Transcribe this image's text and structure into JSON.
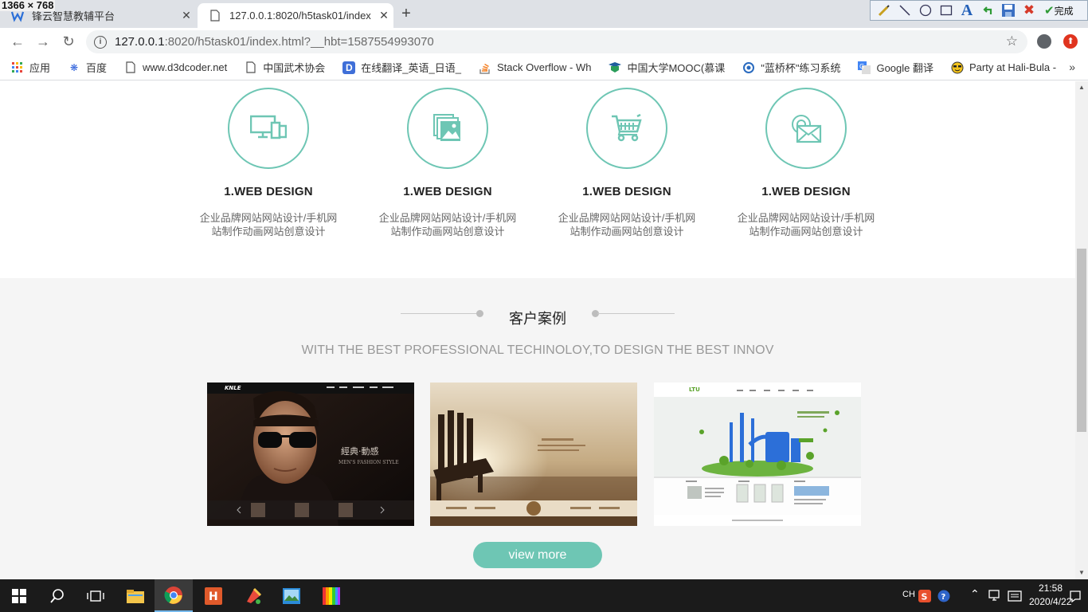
{
  "screenshot_dims": "1366 × 768",
  "browser": {
    "tabs": [
      {
        "title": "锋云智慧教辅平台",
        "active": false
      },
      {
        "title": "127.0.0.1:8020/h5task01/index",
        "active": true
      }
    ],
    "url_host": "127.0.0.1",
    "url_rest": ":8020/h5task01/index.html?__hbt=1587554993070",
    "bookmarks": [
      {
        "label": "应用",
        "icon": "apps-grid-icon"
      },
      {
        "label": "百度",
        "icon": "baidu-paw-icon"
      },
      {
        "label": "www.d3dcoder.net",
        "icon": "page-icon"
      },
      {
        "label": "中国武术协会",
        "icon": "page-icon"
      },
      {
        "label": "在线翻译_英语_日语_",
        "icon": "d-icon"
      },
      {
        "label": "Stack Overflow - Wh",
        "icon": "stackoverflow-icon"
      },
      {
        "label": "中国大学MOOC(慕课",
        "icon": "mooc-icon"
      },
      {
        "label": "\"蓝桥杯\"练习系统",
        "icon": "lanqiao-icon"
      },
      {
        "label": "Google 翻译",
        "icon": "google-translate-icon"
      },
      {
        "label": "Party at Hali-Bula -",
        "icon": "smiley-icon"
      }
    ],
    "toolbar_done_label": "完成"
  },
  "services": [
    {
      "icon": "monitor-devices-icon",
      "title": "1.WEB DESIGN",
      "desc": "企业品牌网站网站设计/手机网站制作动画网站创意设计"
    },
    {
      "icon": "gallery-image-icon",
      "title": "1.WEB DESIGN",
      "desc": "企业品牌网站网站设计/手机网站制作动画网站创意设计"
    },
    {
      "icon": "shopping-cart-icon",
      "title": "1.WEB DESIGN",
      "desc": "企业品牌网站网站设计/手机网站制作动画网站创意设计"
    },
    {
      "icon": "mail-envelope-icon",
      "title": "1.WEB DESIGN",
      "desc": "企业品牌网站网站设计/手机网站制作动画网站创意设计"
    }
  ],
  "cases": {
    "title": "客户案例",
    "subtitle": "WITH THE BEST PROFESSIONAL TECHINOLOY,TO DESIGN THE BEST INNOV",
    "shots": [
      {
        "name": "fashion-site-thumbnail",
        "caption": "經典·動感",
        "caption_en": "MEN'S FASHION STYLE",
        "brand": "KNLE"
      },
      {
        "name": "lakeside-chair-thumbnail"
      },
      {
        "name": "green-factory-thumbnail"
      }
    ],
    "button": "view more"
  },
  "taskbar": {
    "ime": "CH",
    "time": "21:58",
    "date": "2020/4/22"
  },
  "colors": {
    "accent": "#6ec6b4",
    "cases_bg": "#f5f5f5",
    "taskbar": "#1b1b1b"
  }
}
